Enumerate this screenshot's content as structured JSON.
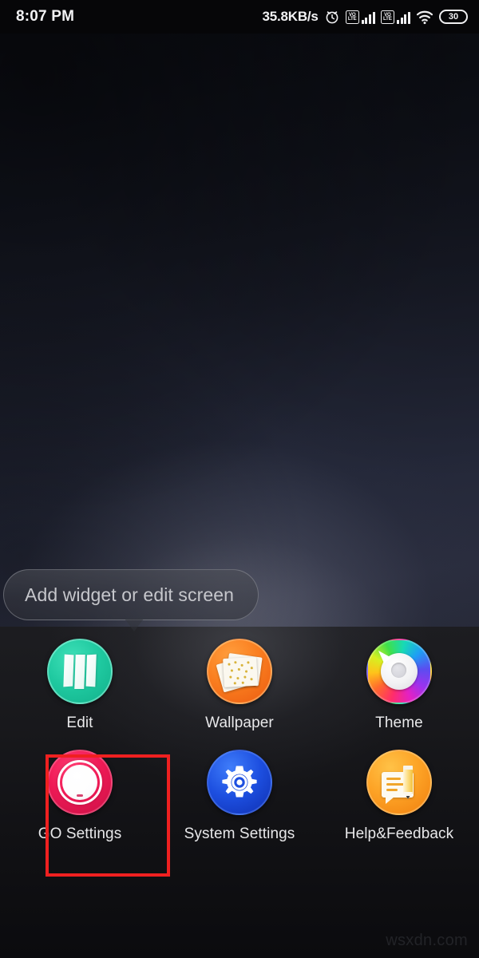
{
  "status_bar": {
    "time": "8:07 PM",
    "network_speed": "35.8KB/s",
    "alarm_icon": "alarm-clock-icon",
    "sim1": {
      "volte_line1": "VO",
      "volte_line2": "LTE",
      "signal_bars": 4
    },
    "sim2": {
      "volte_line1": "VO",
      "volte_line2": "LTE",
      "signal_bars": 4
    },
    "wifi_icon": "wifi-icon",
    "battery_level": "30"
  },
  "tooltip": {
    "text": "Add widget or edit screen"
  },
  "menu": {
    "rows": [
      [
        {
          "label": "Edit",
          "icon": "edit-pages-icon",
          "color": "#1fc9a0"
        },
        {
          "label": "Wallpaper",
          "icon": "wallpaper-sheets-icon",
          "color": "#fa7f20"
        },
        {
          "label": "Theme",
          "icon": "theme-color-wheel-icon",
          "color": "#ff2d6a"
        }
      ],
      [
        {
          "label": "GO Settings",
          "icon": "go-settings-dial-icon",
          "color": "#ef1a56"
        },
        {
          "label": "System Settings",
          "icon": "gear-icon",
          "color": "#1d4fe0"
        },
        {
          "label": "Help&Feedback",
          "icon": "help-feedback-pencil-icon",
          "color": "#fda326"
        }
      ]
    ]
  },
  "highlight": {
    "target": "GO Settings",
    "color": "#ef2020"
  },
  "watermark": {
    "text": "wsxdn.com"
  }
}
